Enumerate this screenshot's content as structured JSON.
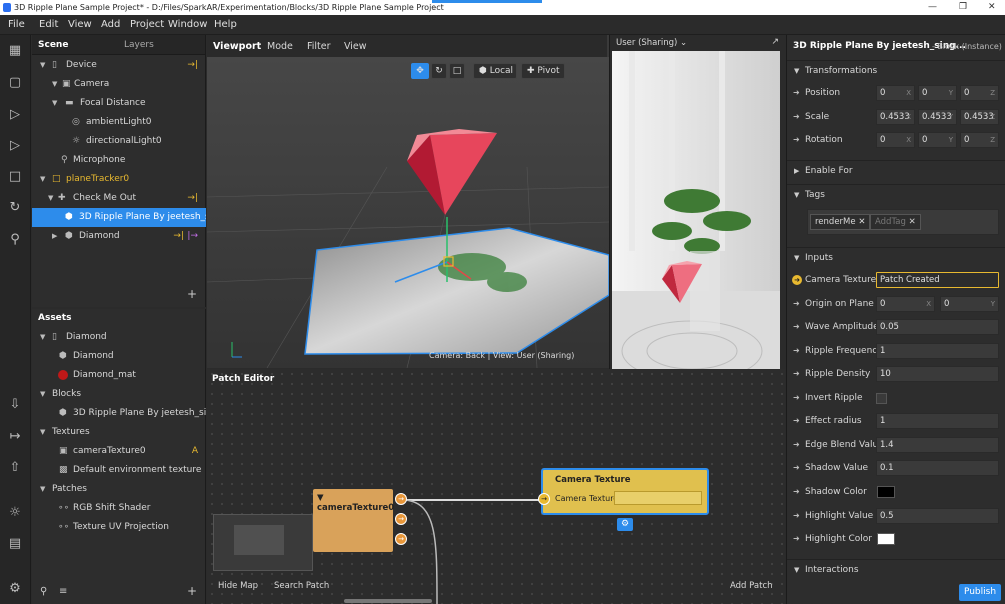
{
  "window": {
    "title": "3D Ripple Plane Sample Project* - D:/Files/SparkAR/Experimentation/Blocks/3D Ripple Plane Sample Project"
  },
  "menu": [
    "File",
    "Edit",
    "View",
    "Add",
    "Project",
    "Window",
    "Help"
  ],
  "scene": {
    "tabs": [
      "Scene",
      "Layers"
    ],
    "rows": [
      {
        "label": "Device"
      },
      {
        "label": "Camera"
      },
      {
        "label": "Focal Distance"
      },
      {
        "label": "ambientLight0"
      },
      {
        "label": "directionalLight0"
      },
      {
        "label": "Microphone"
      },
      {
        "label": "planeTracker0"
      },
      {
        "label": "Check Me Out"
      },
      {
        "label": "3D Ripple Plane By jeetesh_si..."
      },
      {
        "label": "Diamond"
      }
    ],
    "add": "+"
  },
  "assets": {
    "title": "Assets",
    "rows": [
      {
        "label": "Diamond"
      },
      {
        "label": "Diamond"
      },
      {
        "label": "Diamond_mat"
      },
      {
        "label": "Blocks"
      },
      {
        "label": "3D Ripple Plane By jeetesh_sin..."
      },
      {
        "label": "Textures"
      },
      {
        "label": "cameraTexture0"
      },
      {
        "label": "Default environment texture"
      },
      {
        "label": "Patches"
      },
      {
        "label": "RGB Shift Shader"
      },
      {
        "label": "Texture UV Projection"
      }
    ],
    "badge": "A",
    "add": "+"
  },
  "viewport": {
    "tabs": [
      "Viewport",
      "Mode",
      "Filter",
      "View"
    ],
    "local": "Local",
    "pivot": "Pivot",
    "status": "Camera: Back | View: User (Sharing)"
  },
  "simulator": {
    "device": "User (Sharing)"
  },
  "patch_editor": {
    "title": "Patch Editor",
    "node1": "cameraTexture0",
    "node2_title": "Camera Texture",
    "node2_port": "Camera Texture",
    "hide_map": "Hide Map",
    "search_patch": "Search Patch",
    "add_patch": "Add Patch"
  },
  "inspector": {
    "title": "3D Ripple Plane By jeetesh_sing...",
    "subtitle": "Block (Instance)",
    "transformations": "Transformations",
    "position": {
      "label": "Position",
      "x": "0",
      "y": "0",
      "z": "0"
    },
    "scale": {
      "label": "Scale",
      "x": "0.4533",
      "y": "0.4533",
      "z": "0.4533"
    },
    "rotation": {
      "label": "Rotation",
      "x": "0",
      "y": "0",
      "z": "0"
    },
    "axis_x": "X",
    "axis_y": "Y",
    "axis_z": "Z",
    "enable_for": "Enable For",
    "tags": "Tags",
    "tag1": "renderMe",
    "tag_placeholder": "AddTag",
    "inputs": "Inputs",
    "camera_texture": {
      "label": "Camera Texture",
      "value": "Patch Created"
    },
    "origin_on_plane": {
      "label": "Origin on Plane",
      "x": "0",
      "y": "0"
    },
    "wave_amplitude": {
      "label": "Wave Amplitude",
      "value": "0.05"
    },
    "ripple_frequency": {
      "label": "Ripple Frequency",
      "value": "1"
    },
    "ripple_density": {
      "label": "Ripple Density",
      "value": "10"
    },
    "invert_ripple": {
      "label": "Invert Ripple"
    },
    "effect_radius": {
      "label": "Effect radius",
      "value": "1"
    },
    "edge_blend": {
      "label": "Edge Blend Value",
      "value": "1.4"
    },
    "shadow_value": {
      "label": "Shadow Value",
      "value": "0.1"
    },
    "shadow_color": {
      "label": "Shadow Color",
      "color": "#000000"
    },
    "highlight_value": {
      "label": "Highlight Value",
      "value": "0.5"
    },
    "highlight_color": {
      "label": "Highlight Color",
      "color": "#ffffff"
    },
    "interactions": "Interactions",
    "publish": "Publish"
  },
  "colors": {
    "accent": "#2d8ceb",
    "selection": "#2d8ceb",
    "patch_node": "#d9a25a",
    "camera_node": "#e0c04e",
    "pin": "#e8b930"
  }
}
